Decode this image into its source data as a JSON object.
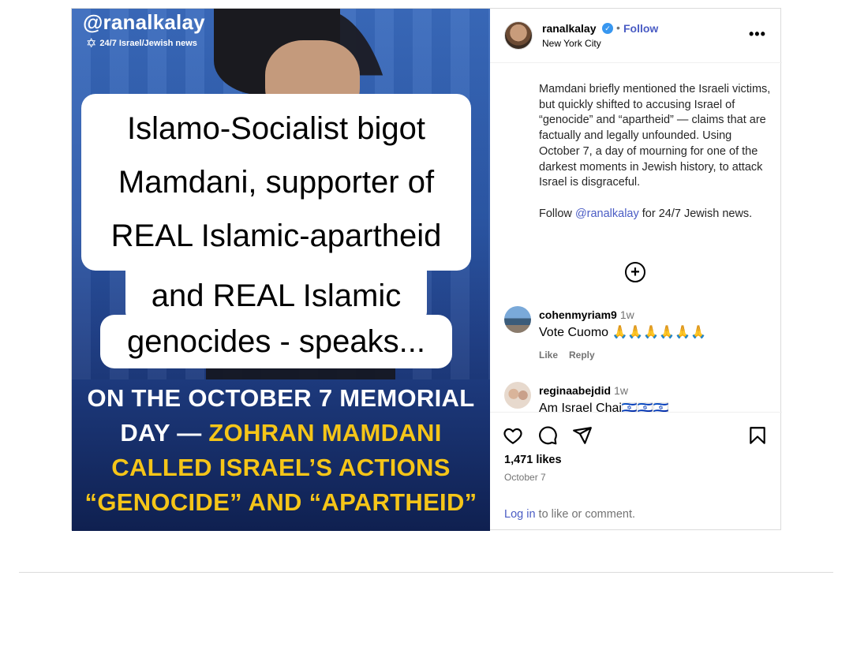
{
  "media": {
    "handle": "@ranalkalay",
    "tagline": "24/7 Israel/Jewish news",
    "bubble_lines": [
      "Islamo-Socialist bigot",
      "Mamdani, supporter of",
      "REAL Islamic-apartheid",
      "and REAL Islamic",
      "genocides - speaks..."
    ],
    "headline": {
      "line1_white": "ON THE OCTOBER 7 MEMORIAL",
      "line2_white": "DAY — ",
      "line2_yellow": "ZOHRAN MAMDANI",
      "line3_yellow": "CALLED ISRAEL’S ACTIONS",
      "line4_yellow": "“GENOCIDE” AND “APARTHEID”"
    },
    "colors": {
      "headline_white": "#ffffff",
      "headline_yellow": "#f5c518",
      "background": "#2c58a8"
    }
  },
  "header": {
    "username": "ranalkalay",
    "verified_icon": "verified-badge-icon",
    "separator": "•",
    "follow_label": "Follow",
    "location": "New York City",
    "more_label": "•••"
  },
  "caption": {
    "paragraph": "Mamdani briefly mentioned the Israeli victims, but quickly shifted to accusing Israel of “genocide” and “apartheid” — claims that are factually and legally unfounded. Using October 7, a day of mourning for one of the darkest moments in Jewish history, to attack Israel is disgraceful.",
    "follow_prefix": "Follow ",
    "follow_mention": "@ranalkalay",
    "follow_suffix": " for 24/7 Jewish news."
  },
  "load_more_icon": "plus-circle-icon",
  "comments": [
    {
      "user": "cohenmyriam9",
      "time": "1w",
      "text": "Vote Cuomo 🙏🙏🙏🙏🙏🙏",
      "like_label": "Like",
      "reply_label": "Reply"
    },
    {
      "user": "reginaabejdid",
      "time": "1w",
      "text": "Am Israel Chai🇮🇱🇮🇱🇮🇱"
    }
  ],
  "actions": {
    "icons": [
      "heart-icon",
      "comment-icon",
      "share-icon",
      "bookmark-icon"
    ],
    "likes": "1,471 likes",
    "date": "October 7",
    "login_link": "Log in",
    "login_suffix": " to like or comment."
  },
  "colors": {
    "link": "#4a5cc4",
    "muted": "#737373",
    "border": "#dbdbdb"
  }
}
